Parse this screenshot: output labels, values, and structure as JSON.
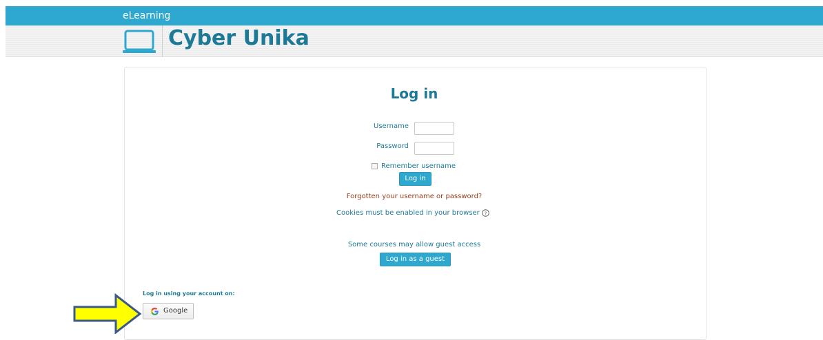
{
  "header": {
    "top_label": "eLearning",
    "site_name": "Cyber Unika"
  },
  "login": {
    "heading": "Log in",
    "username_label": "Username",
    "username_value": "",
    "password_label": "Password",
    "password_value": "",
    "remember_label": "Remember username",
    "remember_checked": false,
    "submit_label": "Log in",
    "forgot_link": "Forgotten your username or password?",
    "cookies_notice": "Cookies must be enabled in your browser",
    "guest_notice": "Some courses may allow guest access",
    "guest_button": "Log in as a guest"
  },
  "oauth": {
    "heading": "Log in using your account on:",
    "google_label": "Google"
  },
  "colors": {
    "brand": "#2fa8cf",
    "heading_text": "#1d7a96",
    "link_text": "#9a3e1c",
    "arrow_fill": "#ffff00",
    "arrow_stroke": "#3b5a8a"
  },
  "icons": [
    "laptop-icon",
    "help-icon",
    "google-icon",
    "pointer-arrow"
  ]
}
